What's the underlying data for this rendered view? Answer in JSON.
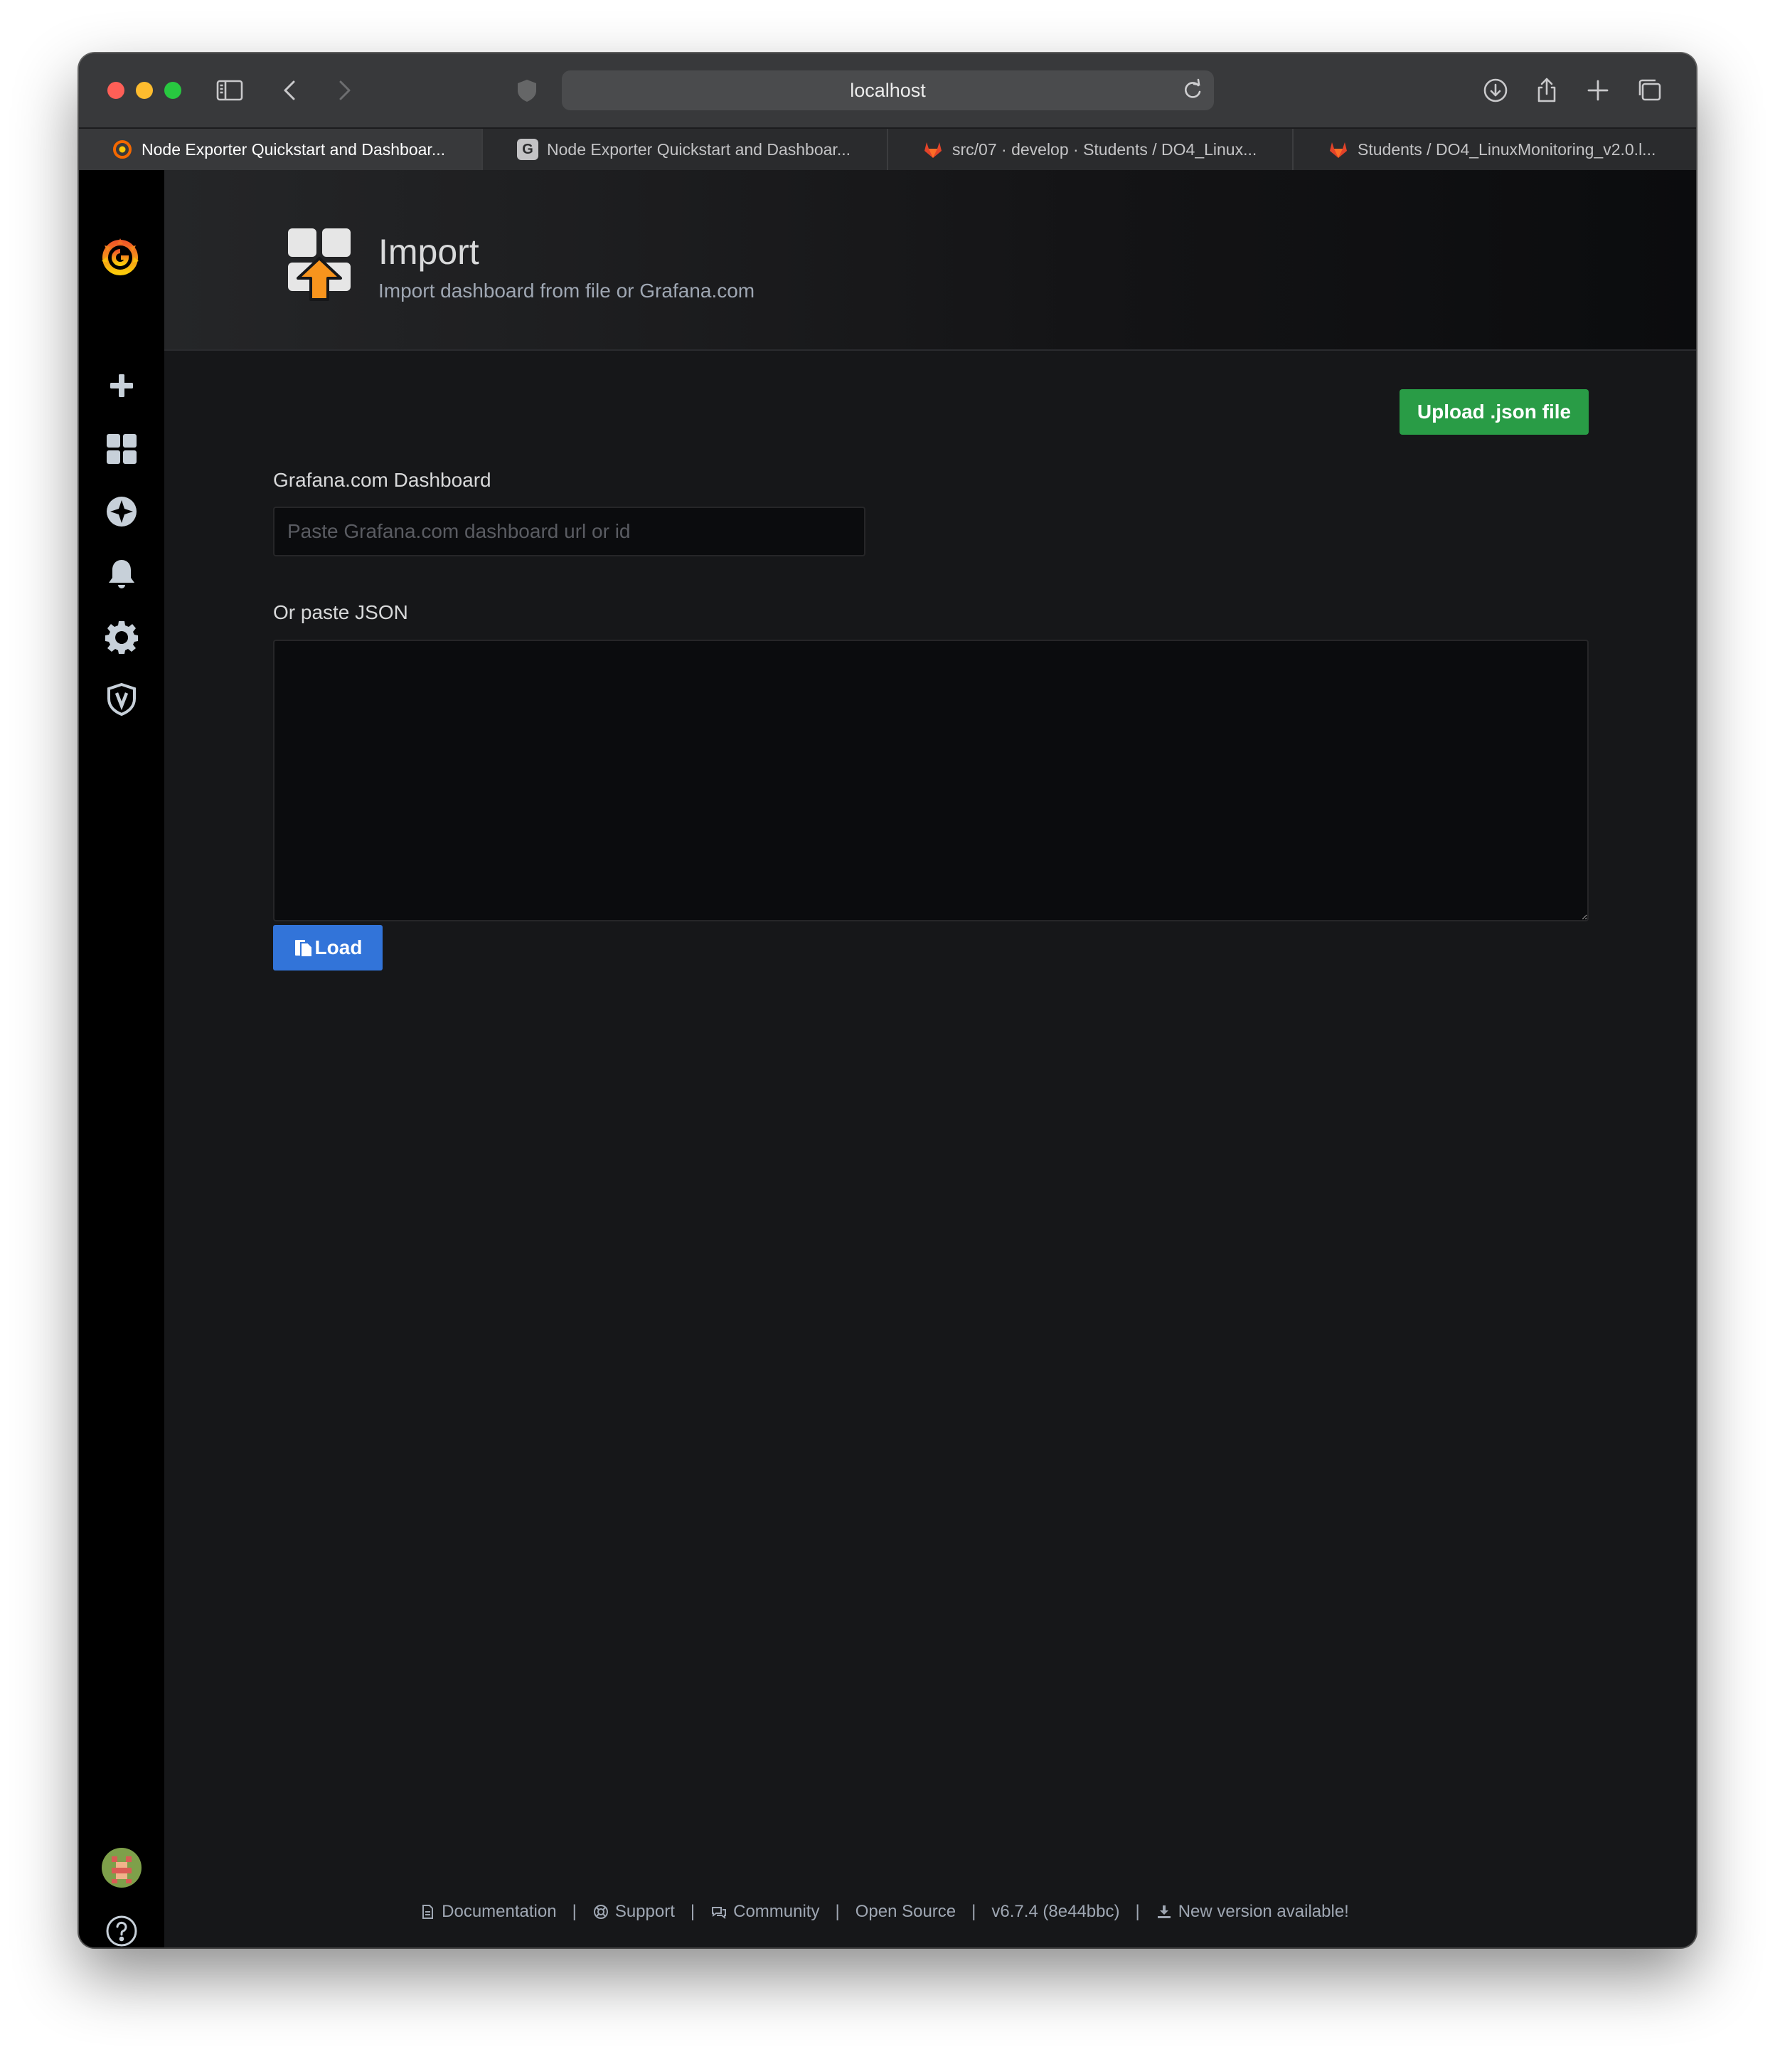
{
  "browser": {
    "url": "localhost",
    "tabs": [
      {
        "title": "Node Exporter Quickstart and Dashboar...",
        "active": true,
        "favicon": "grafana-icon"
      },
      {
        "title": "Node Exporter Quickstart and Dashboar...",
        "active": false,
        "favicon": "g-icon",
        "favicon_letter": "G"
      },
      {
        "title": "src/07 · develop · Students / DO4_Linux...",
        "active": false,
        "favicon": "gitlab-icon"
      },
      {
        "title": "Students / DO4_LinuxMonitoring_v2.0.l...",
        "active": false,
        "favicon": "gitlab-icon"
      }
    ]
  },
  "sidemenu": {
    "items": [
      "grafana-logo-icon",
      "plus-icon",
      "dashboards-icon",
      "explore-icon",
      "alerting-icon",
      "configuration-icon",
      "server-admin-icon",
      "avatar",
      "help-icon"
    ]
  },
  "header": {
    "title": "Import",
    "subtitle": "Import dashboard from file or Grafana.com"
  },
  "content": {
    "upload_label": "Upload .json file",
    "grafana_com_label": "Grafana.com Dashboard",
    "grafana_com_placeholder": "Paste Grafana.com dashboard url or id",
    "grafana_com_value": "",
    "json_label": "Or paste JSON",
    "json_value": "",
    "load_label": "Load"
  },
  "footer": {
    "documentation": "Documentation",
    "support": "Support",
    "community": "Community",
    "open_source": "Open Source",
    "version": "v6.7.4 (8e44bbc)",
    "new_version": "New version available!",
    "separator": "|"
  },
  "colors": {
    "upload_button": "#299c46",
    "load_button": "#3274d9",
    "grafana_orange": "#f46800",
    "gitlab_red": "#e24329"
  }
}
